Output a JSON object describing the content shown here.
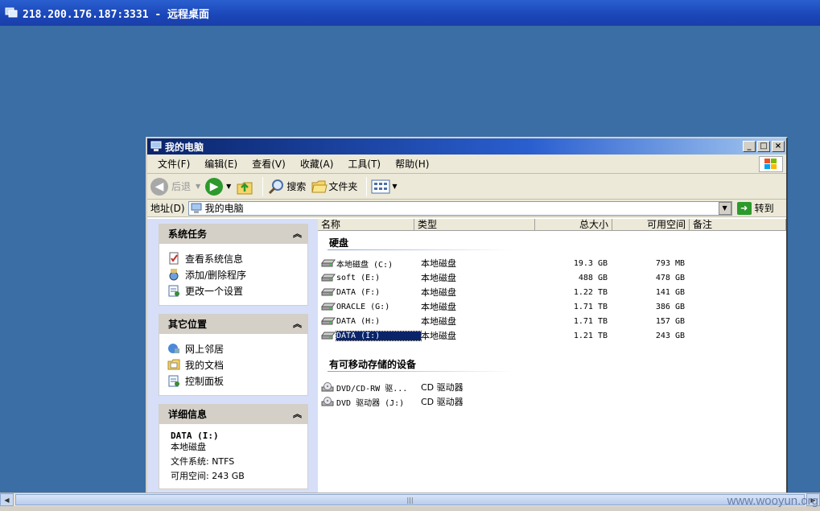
{
  "remote": {
    "title": "218.200.176.187:3331 - 远程桌面"
  },
  "window": {
    "title": "我的电脑",
    "caption_buttons": [
      "_",
      "□",
      "×"
    ]
  },
  "menu": [
    "文件(F)",
    "编辑(E)",
    "查看(V)",
    "收藏(A)",
    "工具(T)",
    "帮助(H)"
  ],
  "toolbar": {
    "back": "后退",
    "search": "搜索",
    "folders": "文件夹"
  },
  "address": {
    "label": "地址(D)",
    "value": "我的电脑",
    "go": "转到"
  },
  "taskpane": {
    "system_tasks": {
      "title": "系统任务",
      "items": [
        "查看系统信息",
        "添加/删除程序",
        "更改一个设置"
      ]
    },
    "other_places": {
      "title": "其它位置",
      "items": [
        "网上邻居",
        "我的文档",
        "控制面板"
      ]
    },
    "details": {
      "title": "详细信息",
      "name": "DATA (I:)",
      "type": "本地磁盘",
      "fs": "文件系统: NTFS",
      "free": "可用空间: 243 GB"
    }
  },
  "columns": [
    "名称",
    "类型",
    "总大小",
    "可用空间",
    "备注"
  ],
  "groups": {
    "hdd": "硬盘",
    "removable": "有可移动存储的设备"
  },
  "drives": [
    {
      "name": "本地磁盘 (C:)",
      "type": "本地磁盘",
      "size": "19.3 GB",
      "free": "793 MB"
    },
    {
      "name": "soft (E:)",
      "type": "本地磁盘",
      "size": "488 GB",
      "free": "478 GB"
    },
    {
      "name": "DATA (F:)",
      "type": "本地磁盘",
      "size": "1.22 TB",
      "free": "141 GB"
    },
    {
      "name": "ORACLE (G:)",
      "type": "本地磁盘",
      "size": "1.71 TB",
      "free": "386 GB"
    },
    {
      "name": "DATA (H:)",
      "type": "本地磁盘",
      "size": "1.71 TB",
      "free": "157 GB"
    },
    {
      "name": "DATA (I:)",
      "type": "本地磁盘",
      "size": "1.21 TB",
      "free": "243 GB"
    }
  ],
  "removable": [
    {
      "name": "DVD/CD-RW 驱...",
      "type": "CD 驱动器"
    },
    {
      "name": "DVD 驱动器 (J:)",
      "type": "CD 驱动器"
    }
  ],
  "watermark": "www.wooyun.org",
  "colors": {
    "desktop": "#3a6ea5",
    "title_active": "#0a246a",
    "selection": "#0a246a"
  }
}
